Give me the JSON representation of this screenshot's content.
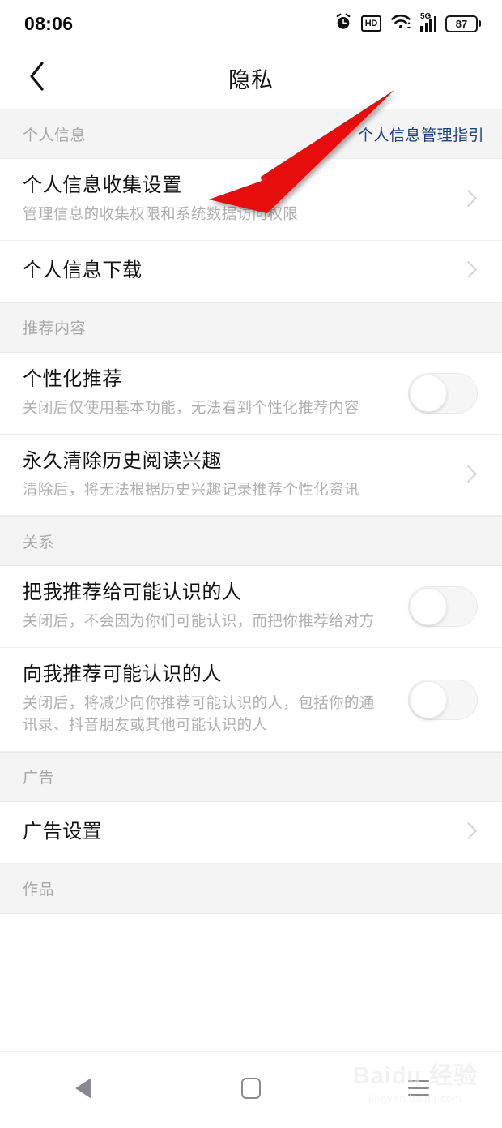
{
  "statusbar": {
    "time": "08:06",
    "icons": [
      "alarm-clock-icon",
      "hd-icon",
      "wifi-icon",
      "signal-5g-icon",
      "battery-icon"
    ],
    "hd_label": "HD",
    "network_label": "5G",
    "battery_percent": "87"
  },
  "navbar": {
    "title": "隐私",
    "back_icon": "chevron-left-icon"
  },
  "sections": [
    {
      "title": "个人信息",
      "link": "个人信息管理指引",
      "rows": [
        {
          "title": "个人信息收集设置",
          "sub": "管理信息的收集权限和系统数据访问权限",
          "control": "chevron"
        },
        {
          "title": "个人信息下载",
          "sub": "",
          "control": "chevron"
        }
      ]
    },
    {
      "title": "推荐内容",
      "link": "",
      "rows": [
        {
          "title": "个性化推荐",
          "sub": "关闭后仅使用基本功能，无法看到个性化推荐内容",
          "control": "toggle",
          "toggle_on": false
        },
        {
          "title": "永久清除历史阅读兴趣",
          "sub": "清除后，将无法根据历史兴趣记录推荐个性化资讯",
          "control": "chevron"
        }
      ]
    },
    {
      "title": "关系",
      "link": "",
      "rows": [
        {
          "title": "把我推荐给可能认识的人",
          "sub": "关闭后，不会因为你们可能认识，而把你推荐给对方",
          "control": "toggle",
          "toggle_on": false
        },
        {
          "title": "向我推荐可能认识的人",
          "sub": "关闭后，将减少向你推荐可能认识的人，包括你的通讯录、抖音朋友或其他可能认识的人",
          "control": "toggle",
          "toggle_on": false
        }
      ]
    },
    {
      "title": "广告",
      "link": "",
      "rows": [
        {
          "title": "广告设置",
          "sub": "",
          "control": "chevron"
        }
      ]
    },
    {
      "title": "作品",
      "link": "",
      "rows": []
    }
  ],
  "annotation": {
    "type": "arrow",
    "color": "#e8110f",
    "points_to": "个人信息收集设置"
  },
  "watermark": {
    "main": "Baidu 经验",
    "sub": "jingyan.baidu.com"
  },
  "bottomnav": {
    "back_label": "back-triangle-icon",
    "home_label": "home-square-icon",
    "recents_label": "menu-lines-icon"
  }
}
